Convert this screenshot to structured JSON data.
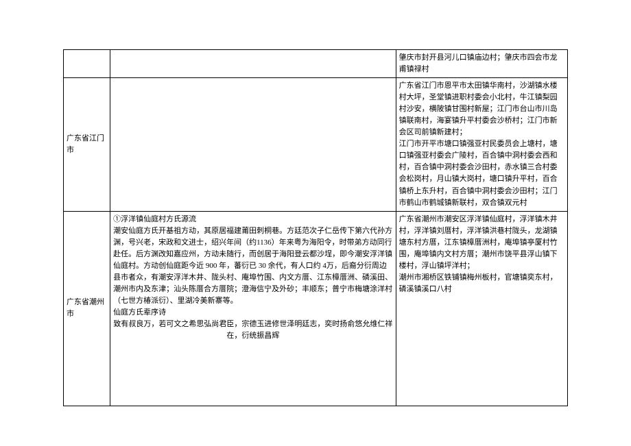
{
  "rows": [
    {
      "col1": "",
      "col2": "",
      "col3": "肇庆市封开县河儿口镇庙边村；肇庆市四会市龙甫镇禄村"
    },
    {
      "col1": "广东省江门市",
      "col2": "",
      "col3": "广东省江门市恩平市太田镇华南村，沙湖镇水楼村大坪，圣堂镇进职村委会小北村，牛江镇梨园村沙安，横陂镇甘围村新屋；江门市台山市川岛镇联南村，海宴镇升平村委会沙桥村；江门市新会区司前镇新建村；\n江门市开平市塘口镇强亚村民委员会上塘村，塘口镇强亚村委会广陵村，百合镇中洞村委会西和村，百合镇中洞村委会沙田村，赤水镇三合村委会松岗村，月山镇大岗村，塘口镇升平村，百合镇桥上东升村，百合镇中洞村委会沙田村；江门市鹤山市鹤城镇新联村，双合镇双元村"
    },
    {
      "col1": "广东省潮州市",
      "col2_p1": "①浮洋镇仙庭村方氏源流",
      "col2_p2": "潮安仙庭方氏开基祖方动，其原居福建莆田刺桐巷。方廷范次子仁岳传下第六代孙方渊，号兴老，宋政和文进士，绍兴年间（约1136）年来粤为海阳令，时带弟方动同行赴任。后方渊改知嘉应州，方动未随行，而创居于海阳登云都沙埕，即今潮安浮洋镇仙庭村。方动创仙庭距今近 900 年，蕃衍已 30 余代，有人口约 4万，后裔分衍周边县市者众，有潮安浮洋木井、陇头村、庵埠竹围、内文方厝、江东樟厝洲、磷溪田、潮州市内及东津；汕头陈厝合方厝院；澄海信宁及外砂；丰顺东；普宁市梅塘涂洋村（七世方椿派衍）、里湖冷美新寨等。",
      "col2_p3": "仙庭方氏辈序诗",
      "col2_p4": "致有叔良万，若可文之希思弘尚君臣，宗德玉进修世泽明廷志，奕时扬俞悠允维仁祥在，衍统振昌辉",
      "col3": "广东省潮州市潮安区浮洋镇仙庭村，浮洋镇木井村，浮洋镇刘厝村，浮洋镇洪巷村陇头，龙湖镇塘东村方厝，江东镇樟厝洲村，庵埠镇亭厦村竹围，庵埠镇内文村方厝；潮州市饶平县浮山镇下楼村，浮山镇坪洋村；\n潮州市湘桥区铁铺镇梅州板村，官塘镇奕东村，磷溪镇溪口八村"
    }
  ]
}
